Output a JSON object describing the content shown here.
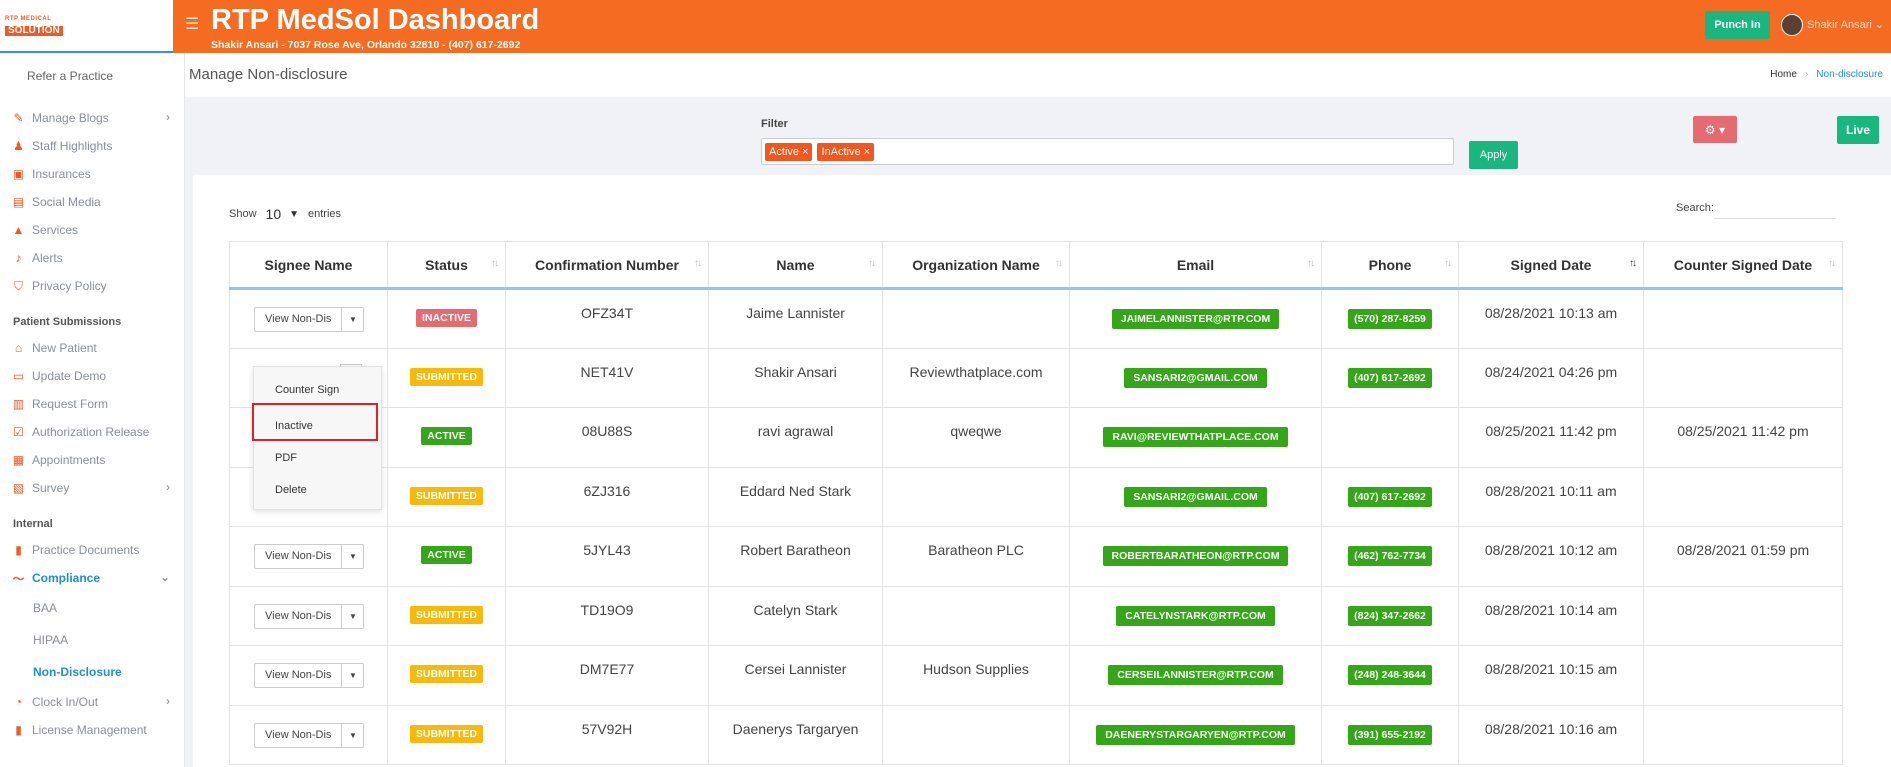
{
  "logo": {
    "line1": "RTP MEDICAL",
    "line2": "SOLUTION"
  },
  "sidebar": {
    "refer": "Refer a Practice",
    "group1": [
      {
        "label": "Manage Blogs",
        "icon": "blog-icon",
        "chevron": true
      },
      {
        "label": "Staff Highlights",
        "icon": "staff-icon"
      },
      {
        "label": "Insurances",
        "icon": "insurance-icon"
      },
      {
        "label": "Social Media",
        "icon": "social-icon"
      },
      {
        "label": "Services",
        "icon": "services-icon"
      },
      {
        "label": "Alerts",
        "icon": "alerts-icon"
      },
      {
        "label": "Privacy Policy",
        "icon": "shield-icon"
      }
    ],
    "section_patient": "Patient Submissions",
    "group2": [
      {
        "label": "New Patient",
        "icon": "home-icon"
      },
      {
        "label": "Update Demo",
        "icon": "id-card-icon"
      },
      {
        "label": "Request Form",
        "icon": "form-icon"
      },
      {
        "label": "Authorization Release",
        "icon": "check-icon"
      },
      {
        "label": "Appointments",
        "icon": "calendar-icon"
      },
      {
        "label": "Survey",
        "icon": "chart-icon",
        "chevron": true
      }
    ],
    "section_internal": "Internal",
    "group3": [
      {
        "label": "Practice Documents",
        "icon": "clipboard-icon"
      },
      {
        "label": "Compliance",
        "icon": "signature-icon",
        "active": true
      }
    ],
    "compliance_sub": [
      {
        "label": "BAA"
      },
      {
        "label": "HIPAA"
      },
      {
        "label": "Non-Disclosure",
        "active": true
      }
    ],
    "group4": [
      {
        "label": "Clock In/Out",
        "icon": "clock-icon",
        "chevron": true
      },
      {
        "label": "License Management",
        "icon": "clipboard-icon"
      }
    ]
  },
  "topbar": {
    "title": "RTP MedSol Dashboard",
    "subtitle": "Shakir Ansari - 7037 Rose Ave, Orlando 32810 - (407) 617-2692",
    "punch": "Punch In",
    "user": "Shakir Ansari"
  },
  "page": {
    "title": "Manage Non-disclosure",
    "breadcrumb_home": "Home",
    "breadcrumb_current": "Non-disclosure"
  },
  "filter": {
    "label": "Filter",
    "chips": [
      "Active ×",
      "InActive ×"
    ],
    "apply": "Apply",
    "live": "Live"
  },
  "table_controls": {
    "show": "Show",
    "entries_value": "10",
    "entries": "entries",
    "search": "Search:"
  },
  "table": {
    "headers": [
      "Signee Name",
      "Status",
      "Confirmation Number",
      "Name",
      "Organization Name",
      "Email",
      "Phone",
      "Signed Date",
      "Counter Signed Date"
    ],
    "action_label": "View Non-Dis",
    "rows": [
      {
        "status": "INACTIVE",
        "conf": "OFZ34T",
        "name": "Jaime Lannister",
        "org": "",
        "email": "JAIMELANNISTER@RTP.COM",
        "phone": "(570) 287-8259",
        "signed": "08/28/2021 10:13 am",
        "counter": ""
      },
      {
        "status": "SUBMITTED",
        "conf": "NET41V",
        "name": "Shakir Ansari",
        "org": "Reviewthatplace.com",
        "email": "SANSARI2@GMAIL.COM",
        "phone": "(407) 617-2692",
        "signed": "08/24/2021 04:26 pm",
        "counter": ""
      },
      {
        "status": "ACTIVE",
        "conf": "08U88S",
        "name": "ravi agrawal",
        "org": "qweqwe",
        "email": "RAVI@REVIEWTHATPLACE.COM",
        "phone": "",
        "signed": "08/25/2021 11:42 pm",
        "counter": "08/25/2021 11:42 pm"
      },
      {
        "status": "SUBMITTED",
        "conf": "6ZJ316",
        "name": "Eddard Ned Stark",
        "org": "",
        "email": "SANSARI2@GMAIL.COM",
        "phone": "(407) 617-2692",
        "signed": "08/28/2021 10:11 am",
        "counter": ""
      },
      {
        "status": "ACTIVE",
        "conf": "5JYL43",
        "name": "Robert Baratheon",
        "org": "Baratheon PLC",
        "email": "ROBERTBARATHEON@RTP.COM",
        "phone": "(462) 762-7734",
        "signed": "08/28/2021 10:12 am",
        "counter": "08/28/2021 01:59 pm"
      },
      {
        "status": "SUBMITTED",
        "conf": "TD19O9",
        "name": "Catelyn Stark",
        "org": "",
        "email": "CATELYNSTARK@RTP.COM",
        "phone": "(824) 347-2662",
        "signed": "08/28/2021 10:14 am",
        "counter": ""
      },
      {
        "status": "SUBMITTED",
        "conf": "DM7E77",
        "name": "Cersei Lannister",
        "org": "Hudson Supplies",
        "email": "CERSEILANNISTER@RTP.COM",
        "phone": "(248) 248-3644",
        "signed": "08/28/2021 10:15 am",
        "counter": ""
      },
      {
        "status": "SUBMITTED",
        "conf": "57V92H",
        "name": "Daenerys Targaryen",
        "org": "",
        "email": "DAENERYSTARGARYEN@RTP.COM",
        "phone": "(391) 655-2192",
        "signed": "08/28/2021 10:16 am",
        "counter": ""
      }
    ]
  },
  "dropdown": {
    "items": [
      "Counter Sign",
      "Inactive",
      "PDF",
      "Delete"
    ]
  },
  "colors": {
    "brand": "#f56b21",
    "green": "#35a619",
    "teal": "#19b77f",
    "link": "#1d8fd8"
  }
}
